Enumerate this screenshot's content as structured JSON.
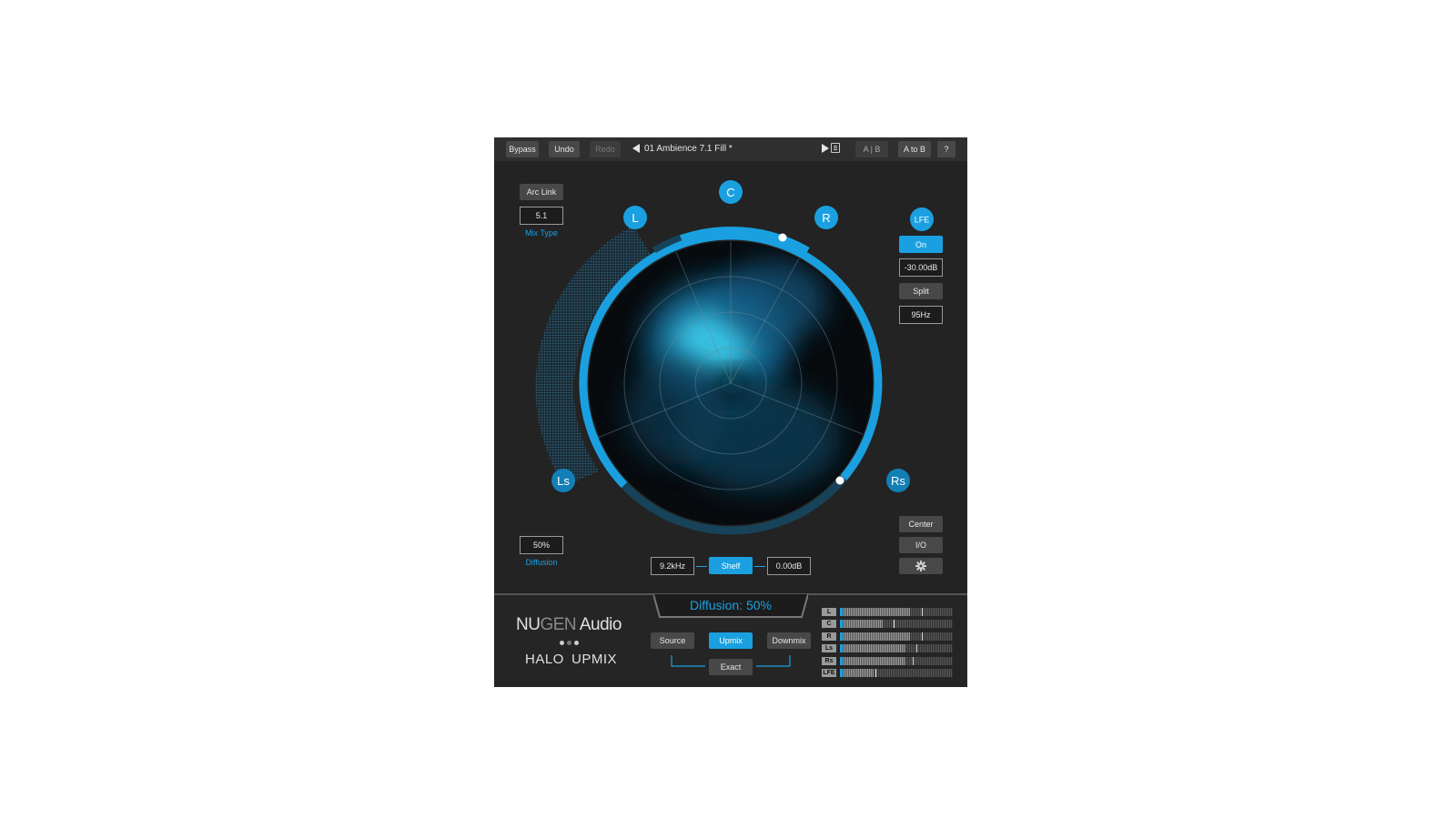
{
  "topbar": {
    "bypass": "Bypass",
    "undo": "Undo",
    "redo": "Redo",
    "preset_name": "01 Ambience 7.1 Fill *",
    "ab": "A | B",
    "a_to_b": "A to B",
    "help": "?"
  },
  "left_panel": {
    "arc_link": "Arc Link",
    "mix_type_value": "5.1",
    "mix_type_label": "Mix Type",
    "diffusion_value": "50%",
    "diffusion_label": "Diffusion"
  },
  "speakers": {
    "c": "C",
    "l": "L",
    "r": "R",
    "ls": "Ls",
    "rs": "Rs"
  },
  "lfe_panel": {
    "badge": "LFE",
    "on": "On",
    "gain": "-30.00dB",
    "split": "Split",
    "frequency": "95Hz"
  },
  "right_tools": {
    "center": "Center",
    "io": "I/O"
  },
  "eq": {
    "frequency": "9.2kHz",
    "mode": "Shelf",
    "gain": "0.00dB"
  },
  "bottom": {
    "readout": "Diffusion: 50%",
    "logo_nu": "NU",
    "logo_gen": "GEN",
    "logo_audio": " Audio",
    "product_left": "HALO",
    "product_right": "UPMIX",
    "source": "Source",
    "upmix": "Upmix",
    "downmix": "Downmix",
    "exact": "Exact"
  },
  "meters": [
    {
      "label": "L",
      "level": 0.62,
      "peak": 0.71
    },
    {
      "label": "C",
      "level": 0.38,
      "peak": 0.46
    },
    {
      "label": "R",
      "level": 0.62,
      "peak": 0.71
    },
    {
      "label": "Ls",
      "level": 0.58,
      "peak": 0.66
    },
    {
      "label": "Rs",
      "level": 0.58,
      "peak": 0.63
    },
    {
      "label": "LFE",
      "level": 0.3,
      "peak": 0.3
    }
  ],
  "colors": {
    "accent": "#1aa0e0",
    "panel": "#232323"
  }
}
